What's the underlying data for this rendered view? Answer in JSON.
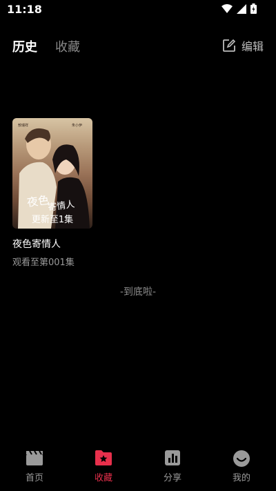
{
  "status": {
    "time": "11:18"
  },
  "tabs": [
    {
      "label": "历史",
      "active": true
    },
    {
      "label": "收藏",
      "active": false
    }
  ],
  "edit": {
    "label": "编辑",
    "icon": "edit-icon"
  },
  "history": [
    {
      "title": "夜色寄情人",
      "overlay": "更新至1集",
      "progress": "观看至第001集",
      "poster_text": "夜色寄情人"
    }
  ],
  "end_text": "-到底啦-",
  "bottom_nav": [
    {
      "label": "首页",
      "icon": "clapperboard-icon",
      "active": false
    },
    {
      "label": "收藏",
      "icon": "star-folder-icon",
      "active": true
    },
    {
      "label": "分享",
      "icon": "bar-chart-icon",
      "active": false
    },
    {
      "label": "我的",
      "icon": "smile-icon",
      "active": false
    }
  ],
  "colors": {
    "accent": "#e8304c",
    "background": "#000000",
    "muted": "#9a9a9a"
  }
}
